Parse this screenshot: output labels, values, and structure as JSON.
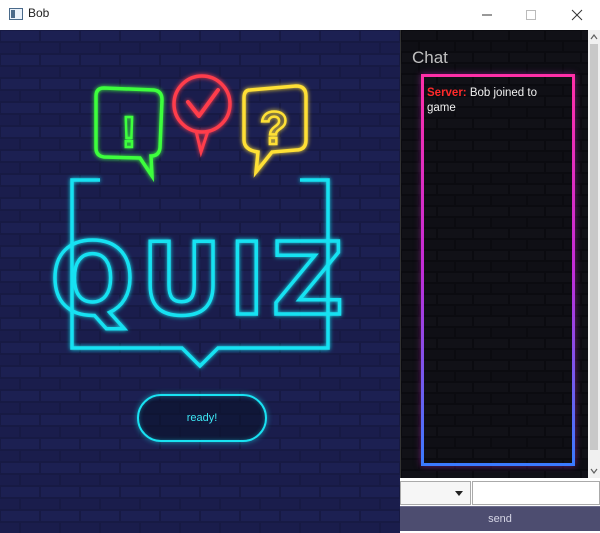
{
  "window": {
    "title": "Bob",
    "icon": "app-window-icon"
  },
  "window_controls": [
    "minimize-icon",
    "maximize-icon",
    "close-icon"
  ],
  "game": {
    "logo_text": "QUIZ",
    "bubble_symbols": [
      "!",
      "✓",
      "?"
    ],
    "ready_label": "ready!",
    "colors": {
      "background": "#14163a",
      "neon_cyan": "#19e2f2",
      "neon_green": "#3cff3c",
      "neon_red": "#ff3c4c",
      "neon_yellow": "#ffe034"
    }
  },
  "chat": {
    "heading": "Chat",
    "messages": [
      {
        "sender": "Server:",
        "text": " Bob joined to game"
      }
    ],
    "recipient_selected": "",
    "input_value": "",
    "send_label": "send",
    "colors": {
      "frame_top": "#ff2fa8",
      "frame_bottom": "#3a7bff",
      "sender": "#ff2a2a"
    }
  }
}
